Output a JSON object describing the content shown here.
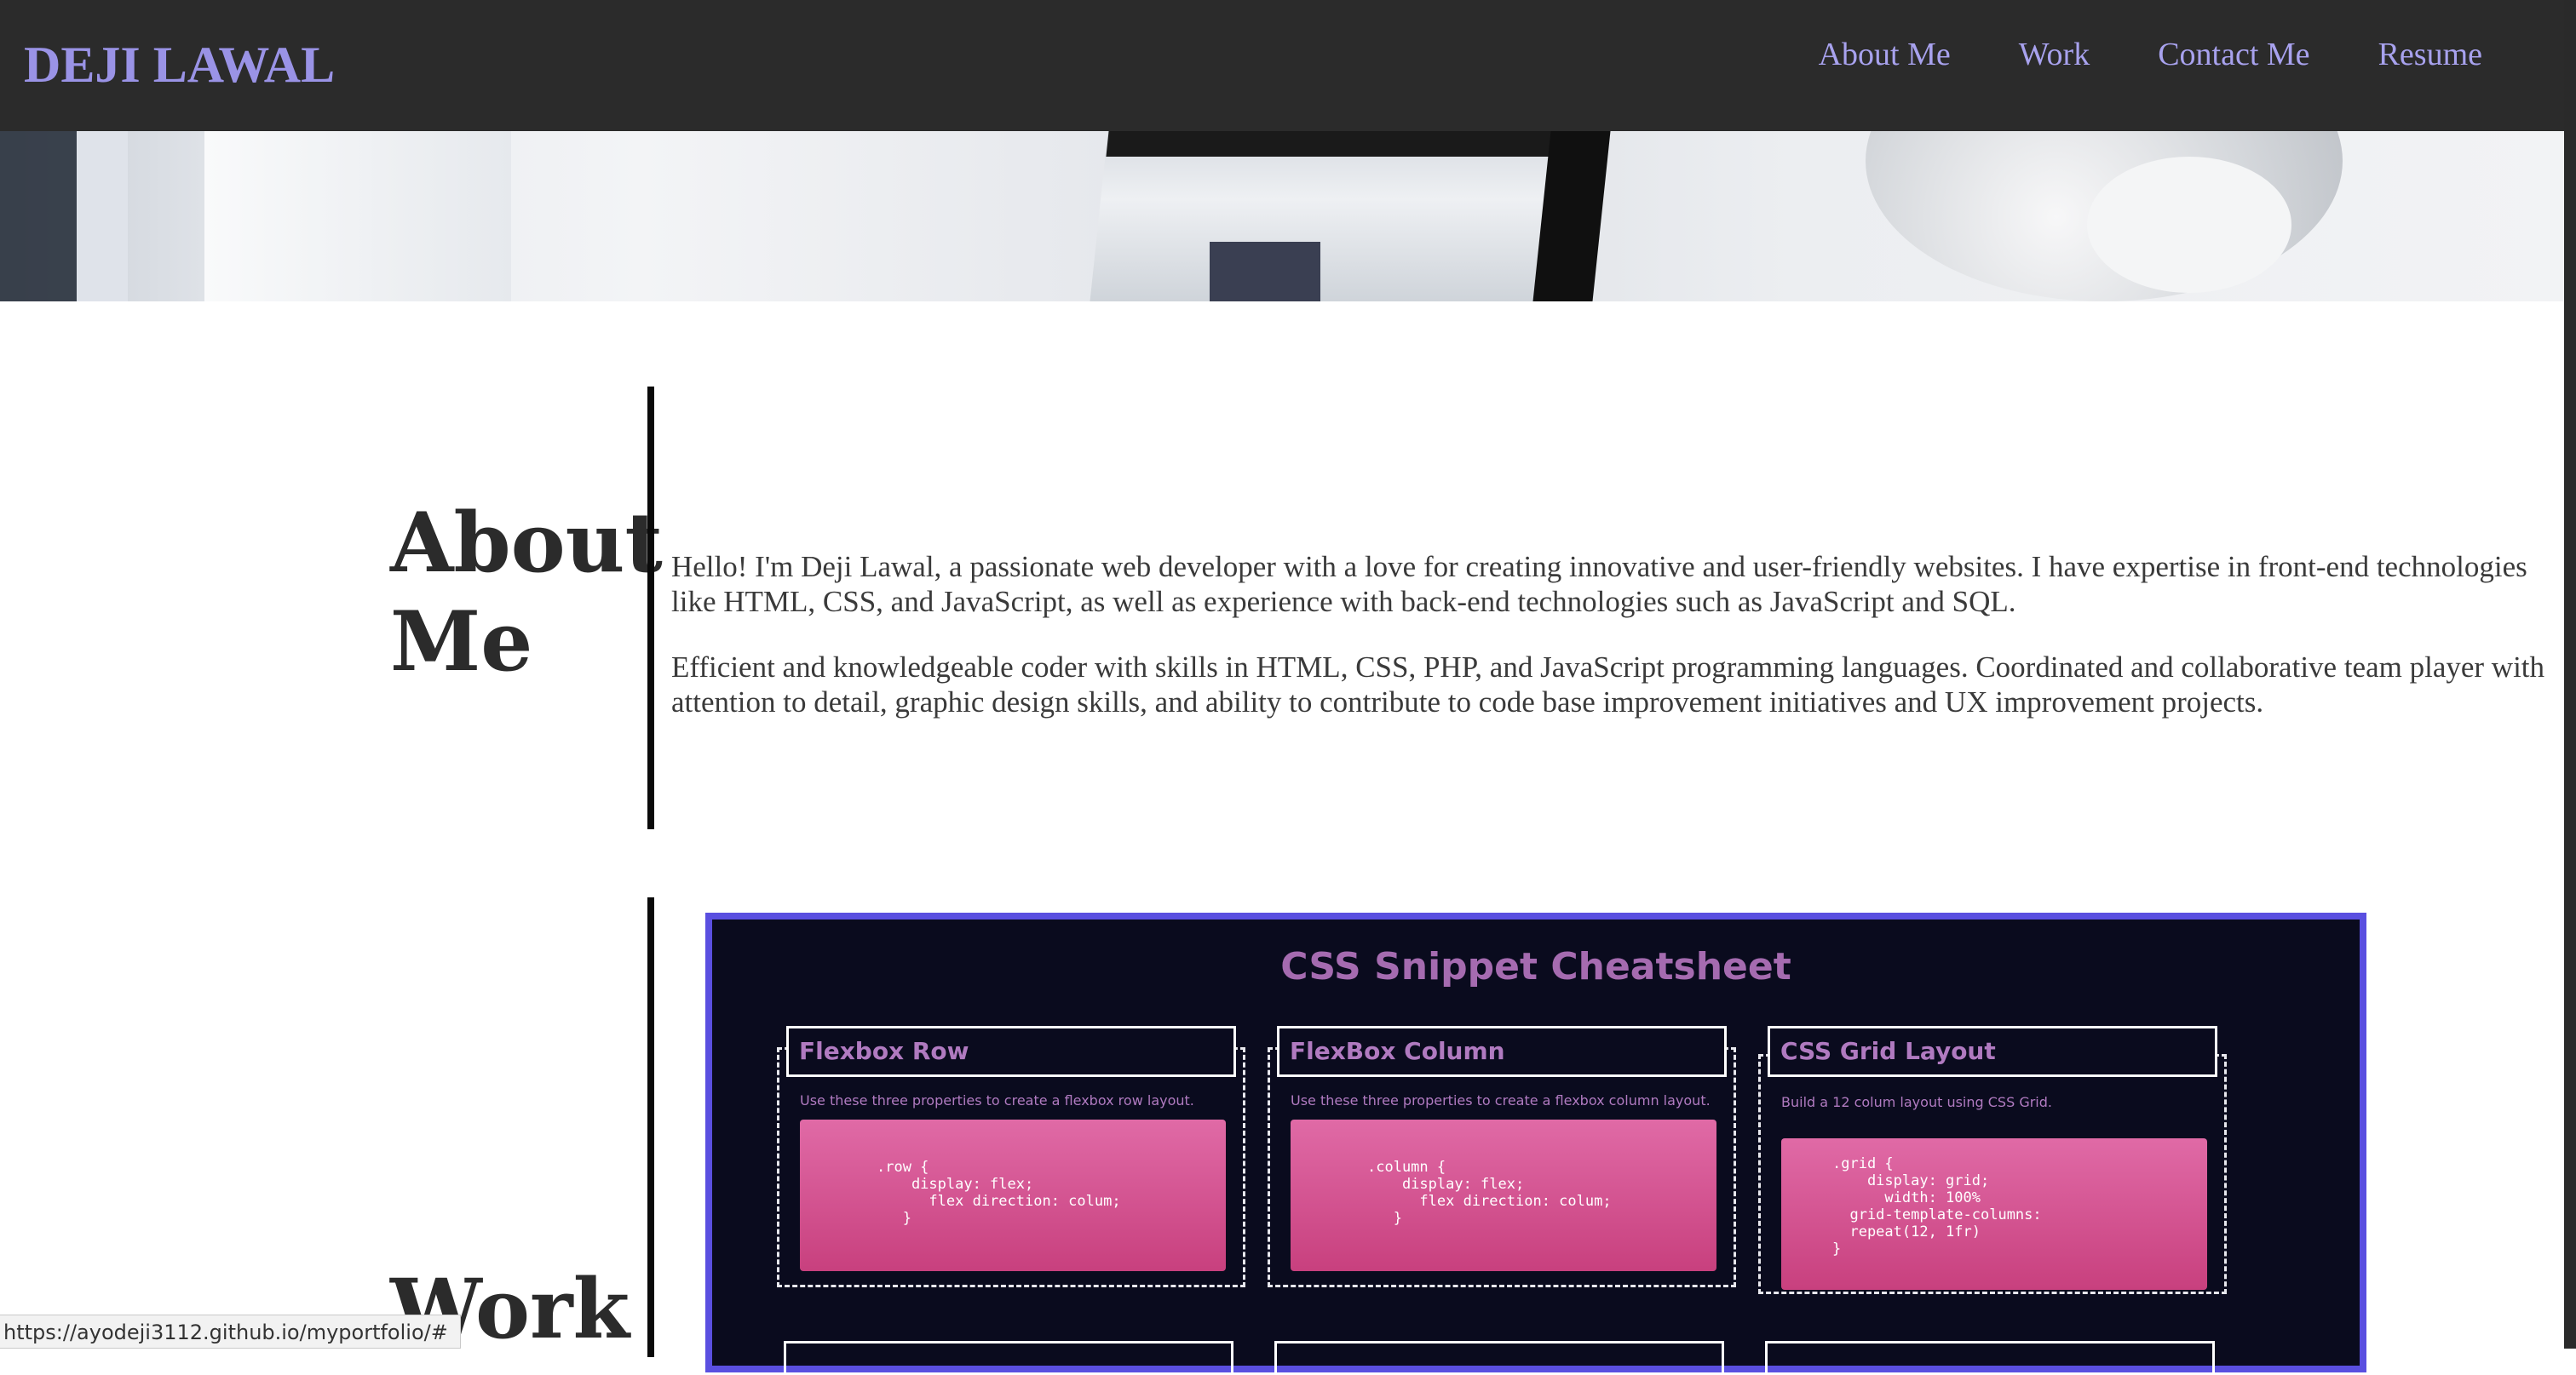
{
  "header": {
    "brand": "DEJI LAWAL",
    "nav": [
      "About Me",
      "Work",
      "Contact Me",
      "Resume"
    ]
  },
  "about": {
    "heading": "About Me",
    "paragraphs": [
      "Hello! I'm Deji Lawal, a passionate web developer with a love for creating innovative and user-friendly websites. I have expertise in front-end technologies like HTML, CSS, and JavaScript, as well as experience with back-end technologies such as JavaScript and SQL.",
      "Efficient and knowledgeable coder with skills in HTML, CSS, PHP, and JavaScript programming languages. Coordinated and collaborative team player with attention to detail, graphic design skills, and ability to contribute to code base improvement initiatives and UX improvement projects."
    ]
  },
  "work": {
    "heading": "Work",
    "project": {
      "title": "CSS Snippet Cheatsheet",
      "cards": [
        {
          "title": "Flexbox Row",
          "description": "Use these three properties to create a flexbox row layout.",
          "code": ".row {\n    display: flex;\n      flex direction: colum;\n   }"
        },
        {
          "title": "FlexBox Column",
          "description": "Use these three properties to create a flexbox column layout.",
          "code": ".column {\n    display: flex;\n      flex direction: colum;\n   }"
        },
        {
          "title": "CSS Grid Layout",
          "description": "Build a 12 colum layout using CSS Grid.",
          "code": ".grid {\n    display: grid;\n      width: 100%\n  grid-template-columns:\n  repeat(12, 1fr)\n}"
        }
      ]
    }
  },
  "status_bar": {
    "url": "https://ayodeji3112.github.io/myportfolio/#"
  },
  "colors": {
    "header_bg": "#2b2b2b",
    "brand": "#9a93e6",
    "nav": "#a8a2ee",
    "card_border": "#5a4fe0",
    "card_bg": "#0a0b1e",
    "accent_pink": "#d4528f"
  }
}
